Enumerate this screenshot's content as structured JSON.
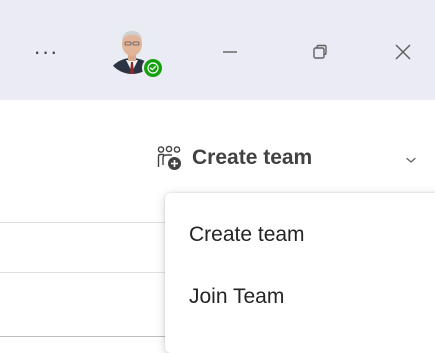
{
  "titlebar": {
    "more_label": "···",
    "avatar_icon": "user-avatar",
    "presence_status": "available",
    "presence_color": "#13a10e",
    "minimize_icon": "minimize-icon",
    "restore_icon": "restore-icon",
    "close_icon": "close-icon",
    "background": "#ebebf5"
  },
  "toolbar": {
    "create_team_icon": "people-team-add-icon",
    "create_team_label": "Create team",
    "dropdown_icon": "chevron-down-icon"
  },
  "menu": {
    "items": [
      {
        "label": "Create team"
      },
      {
        "label": "Join Team"
      }
    ]
  }
}
